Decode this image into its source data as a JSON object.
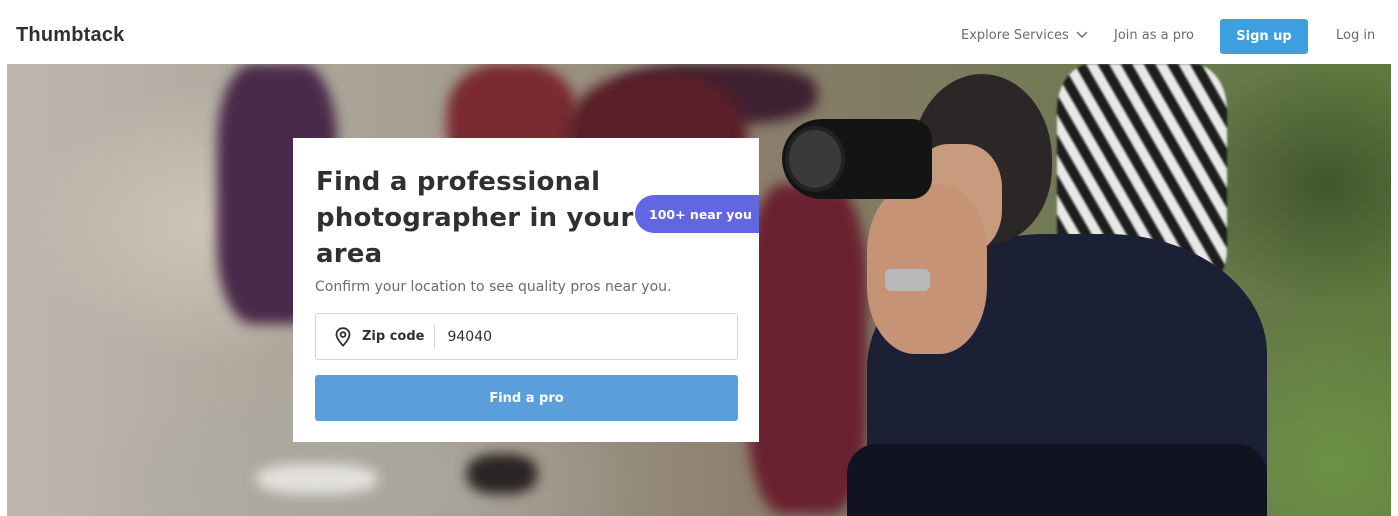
{
  "header": {
    "logo": "Thumbtack",
    "explore_label": "Explore Services",
    "join_label": "Join as a pro",
    "signup_label": "Sign up",
    "login_label": "Log in"
  },
  "hero": {
    "title": "Find a professional photographer in your area",
    "badge": "100+ near you",
    "subtitle": "Confirm your location to see quality pros near you.",
    "zip_label": "Zip code",
    "zip_value": "94040",
    "find_button": "Find a pro"
  },
  "colors": {
    "primary_button": "#3d9fe0",
    "badge": "#6266e3",
    "find_button": "#5a9fdc"
  },
  "icons": [
    "chevron-down-icon",
    "location-pin-icon"
  ]
}
